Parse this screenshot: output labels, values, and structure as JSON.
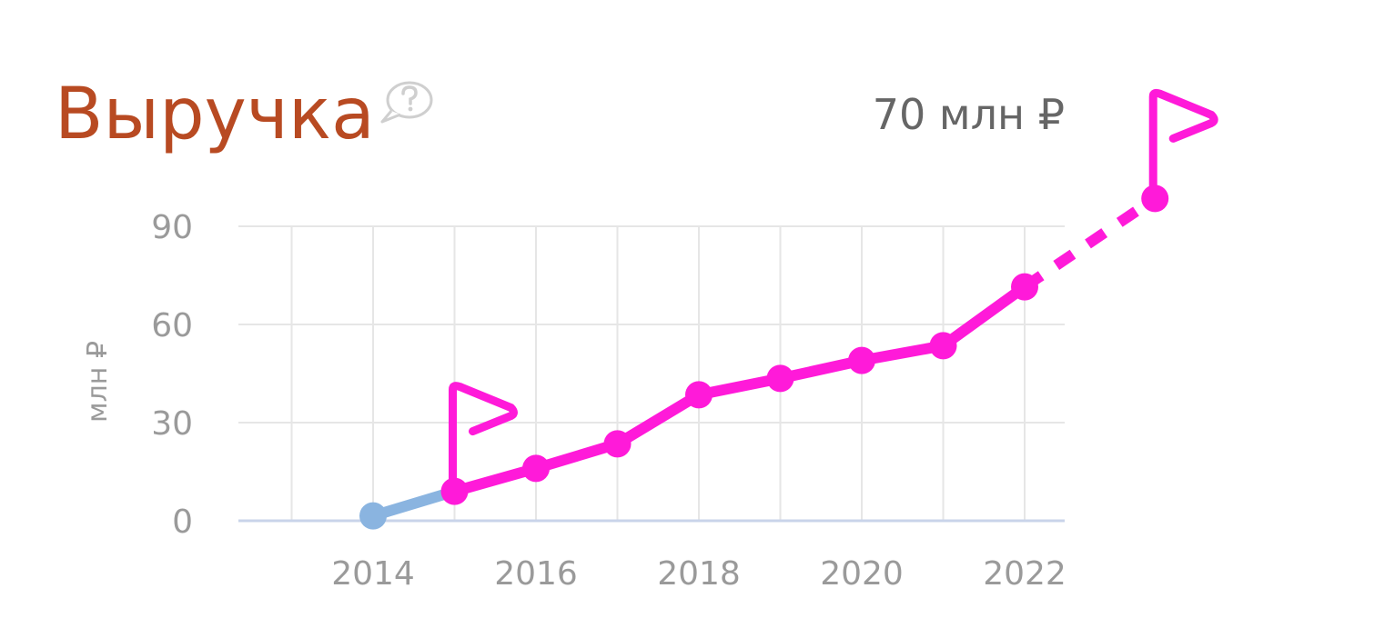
{
  "header": {
    "title": "Выручка",
    "current_value": "70 млн ₽"
  },
  "icons": {
    "help": "question-bubble-icon",
    "flag": "flag-icon"
  },
  "colors": {
    "title": "#b84a22",
    "line": "#ff1ad9",
    "early_segment": "#8ab4e0",
    "grid": "#e6e6e6",
    "axis": "#c9d4ea"
  },
  "chart_data": {
    "type": "line",
    "ylabel": "млн ₽",
    "yticks": [
      0,
      30,
      60,
      90
    ],
    "xticks": [
      2014,
      2016,
      2018,
      2020,
      2022
    ],
    "xlim": [
      2013,
      2022.5
    ],
    "ylim": [
      0,
      90
    ],
    "grid": true,
    "series": [
      {
        "x": [
          2014,
          2015,
          2016,
          2017,
          2018,
          2019,
          2020,
          2021,
          2022
        ],
        "y": [
          1.5,
          9,
          16,
          23.5,
          38.5,
          43.5,
          49,
          53.5,
          71.5
        ]
      }
    ],
    "forecast": {
      "x": 2023.6,
      "y": 98.5
    },
    "flags": [
      2015,
      2023.6
    ]
  }
}
